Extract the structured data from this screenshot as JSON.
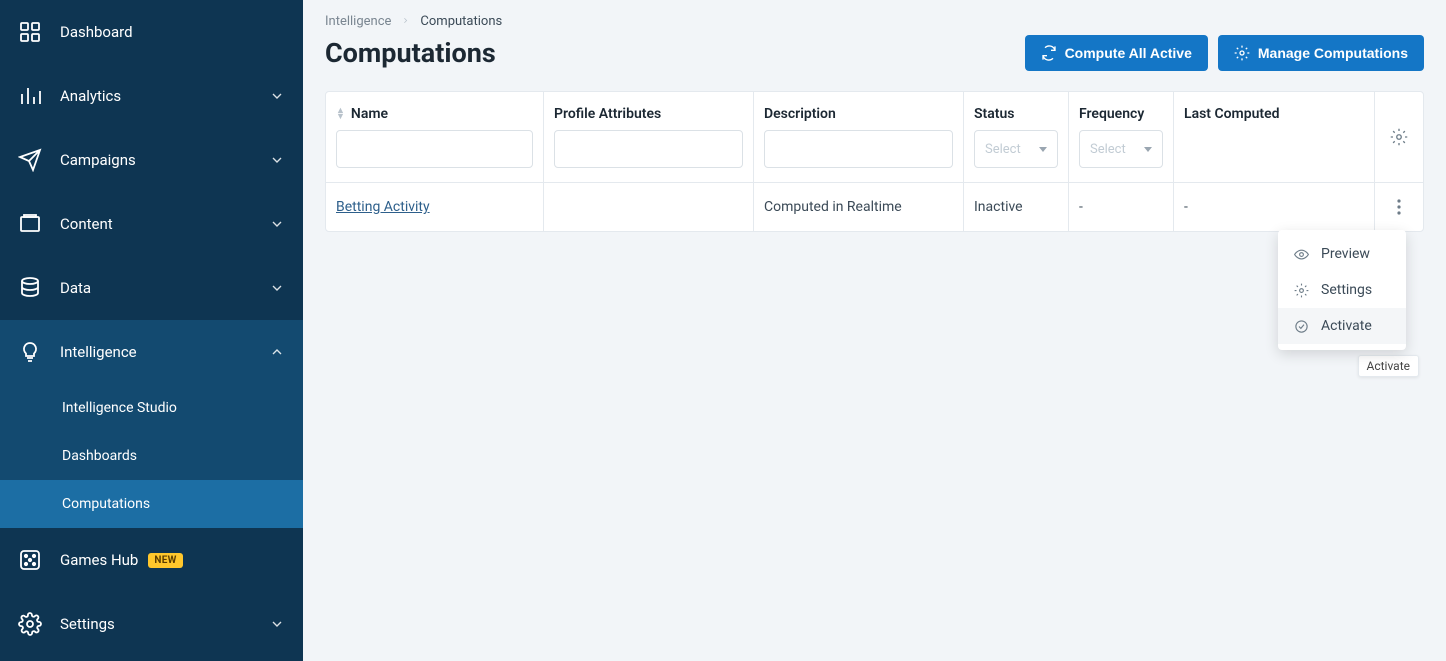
{
  "sidebar": {
    "items": [
      {
        "label": "Dashboard"
      },
      {
        "label": "Analytics"
      },
      {
        "label": "Campaigns"
      },
      {
        "label": "Content"
      },
      {
        "label": "Data"
      },
      {
        "label": "Intelligence"
      },
      {
        "label": "Games Hub"
      },
      {
        "label": "Settings"
      }
    ],
    "intelligenceChildren": [
      {
        "label": "Intelligence Studio"
      },
      {
        "label": "Dashboards"
      },
      {
        "label": "Computations"
      }
    ],
    "newBadge": "NEW"
  },
  "breadcrumb": {
    "parent": "Intelligence",
    "current": "Computations"
  },
  "page": {
    "title": "Computations"
  },
  "buttons": {
    "computeAll": "Compute All Active",
    "manage": "Manage Computations"
  },
  "table": {
    "headers": {
      "name": "Name",
      "profile": "Profile Attributes",
      "desc": "Description",
      "status": "Status",
      "freq": "Frequency",
      "last": "Last Computed"
    },
    "selectPlaceholder": "Select",
    "rows": [
      {
        "name": "Betting Activity",
        "profile": "",
        "desc": "Computed in Realtime",
        "status": "Inactive",
        "freq": "-",
        "last": "-"
      }
    ]
  },
  "menu": {
    "preview": "Preview",
    "settings": "Settings",
    "activate": "Activate"
  },
  "tooltip": "Activate"
}
